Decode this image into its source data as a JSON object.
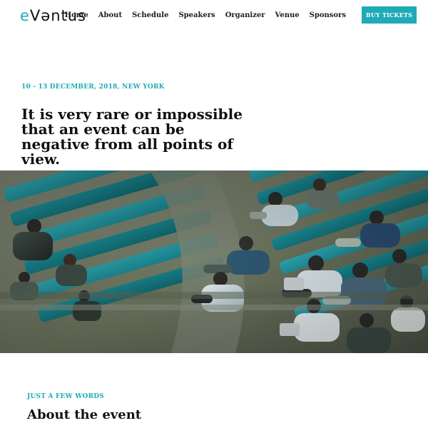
{
  "header": {
    "logo": {
      "accent_letter": "e",
      "rest": "Vəntus"
    },
    "nav": [
      "Home",
      "About",
      "Schedule",
      "Speakers",
      "Organizer",
      "Venue",
      "Sponsors"
    ],
    "cta_label": "BUY TICKETS"
  },
  "hero": {
    "date": "10 - 13 DECEMBER, 2018, NEW YORK",
    "headline": "It is very rare or impossible that an event can be negative from all points of view.",
    "image_icon": "auditorium-photo"
  },
  "about": {
    "eyebrow": "JUST A FEW WORDS",
    "title": "About the event"
  },
  "colors": {
    "accent": "#1eaab6",
    "text": "#111111",
    "background": "#ffffff"
  }
}
